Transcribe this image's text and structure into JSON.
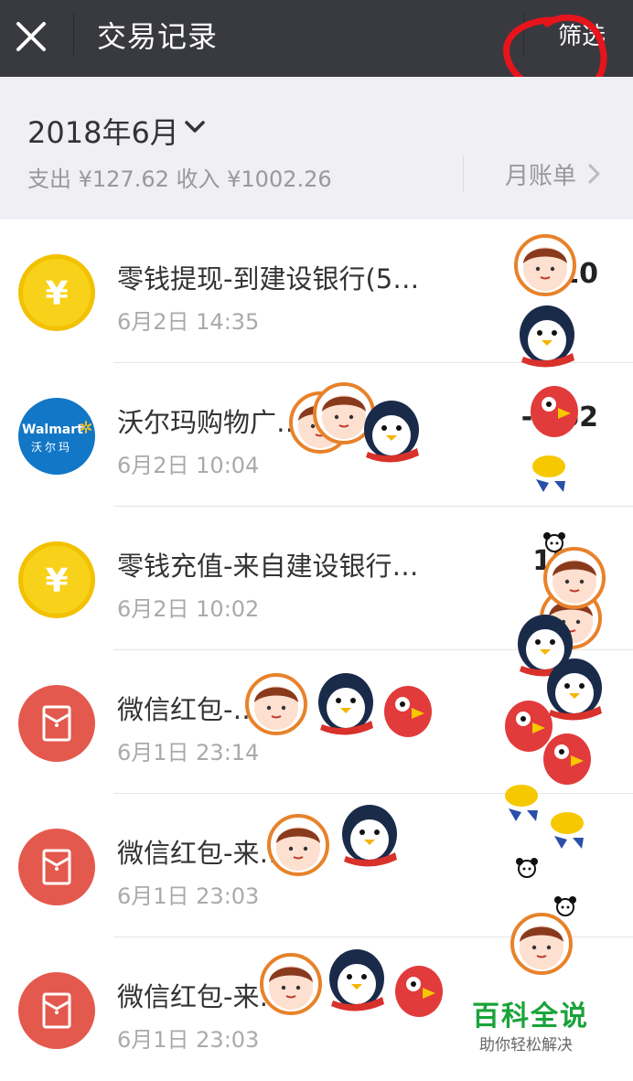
{
  "header": {
    "title": "交易记录",
    "filter_label": "筛选",
    "bg_color": "#393a3f"
  },
  "summary": {
    "month": "2018年6月",
    "totals": "支出 ¥127.62 收入 ¥1002.26",
    "bill_link": "月账单"
  },
  "transactions": [
    {
      "icon": "coin-icon",
      "icon_text": "¥",
      "name": "零钱提现-到建设银行(5…",
      "time": "6月2日 14:35",
      "amount": "10"
    },
    {
      "icon": "walmart-logo",
      "icon_text": "Walmart",
      "icon_text2": "沃尔玛",
      "name": "沃尔玛购物广…",
      "time": "6月2日 10:04",
      "amount": "-…62"
    },
    {
      "icon": "coin-icon",
      "icon_text": "¥",
      "name": "零钱充值-来自建设银行…",
      "time": "6月2日 10:02",
      "amount": "10…"
    },
    {
      "icon": "red-packet-icon",
      "name": "微信红包-…",
      "time": "6月1日 23:14",
      "amount": ""
    },
    {
      "icon": "red-packet-icon",
      "name": "微信红包-来…",
      "time": "6月1日 23:03",
      "amount": ""
    },
    {
      "icon": "red-packet-icon",
      "name": "微信红包-来…",
      "time": "6月1日 23:03",
      "amount": ""
    }
  ],
  "watermark": {
    "title": "百科全说",
    "subtitle": "助你轻松解决"
  },
  "colors": {
    "coin": "#f8d21a",
    "red_packet": "#e4594d",
    "walmart_blue": "#1177c6",
    "annotation_red": "#e8141c"
  }
}
